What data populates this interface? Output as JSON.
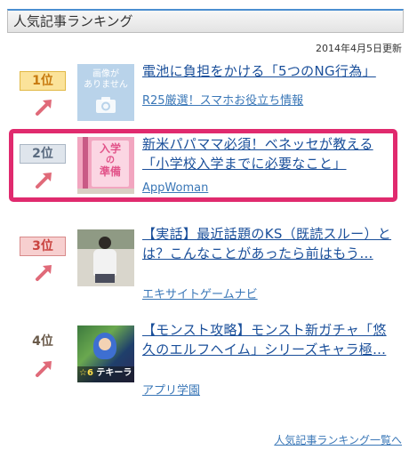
{
  "widget": {
    "title": "人気記事ランキング",
    "updated": "2014年4月5日更新",
    "more_link": "人気記事ランキング一覧へ"
  },
  "items": [
    {
      "rank": "1位",
      "title": "電池に負担をかける「5つのNG行為」",
      "source": "R25厳選！スマホお役立ち情報",
      "thumb_text_1": "画像が",
      "thumb_text_2": "ありません",
      "trend_icon": "trend-up-arrow-icon"
    },
    {
      "rank": "2位",
      "title": "新米パパママ必須！ベネッセが教える「小学校入学までに必要なこと」",
      "source": "AppWoman",
      "thumb_text_1": "入学",
      "thumb_text_2": "の",
      "thumb_text_3": "準備",
      "trend_icon": "trend-up-arrow-icon"
    },
    {
      "rank": "3位",
      "title": "【実話】最近話題のKS（既読スルー）とは？こんなことがあったら前はもう…",
      "source": "エキサイトゲームナビ",
      "trend_icon": "trend-up-arrow-icon"
    },
    {
      "rank": "4位",
      "title": "【モンスト攻略】モンスト新ガチャ「悠久のエルフヘイム」シリーズキャラ極…",
      "source": "アプリ学園",
      "thumb_text_1": "☆6",
      "thumb_text_2": "テキーラ",
      "trend_icon": "trend-up-arrow-icon"
    }
  ],
  "colors": {
    "rank1_bg": "#fbe39a",
    "rank1_border": "#e1b844",
    "rank1_text": "#c77a10",
    "rank2_bg": "#dfe5ec",
    "rank2_border": "#aab6c4",
    "rank2_text": "#5a6b80",
    "rank3_bg": "#f7cfcf",
    "rank3_border": "#d88a8a",
    "rank3_text": "#c9433f",
    "arrow": "#e06a79",
    "highlight": "#e02a6e",
    "link": "#1a4f9a"
  }
}
